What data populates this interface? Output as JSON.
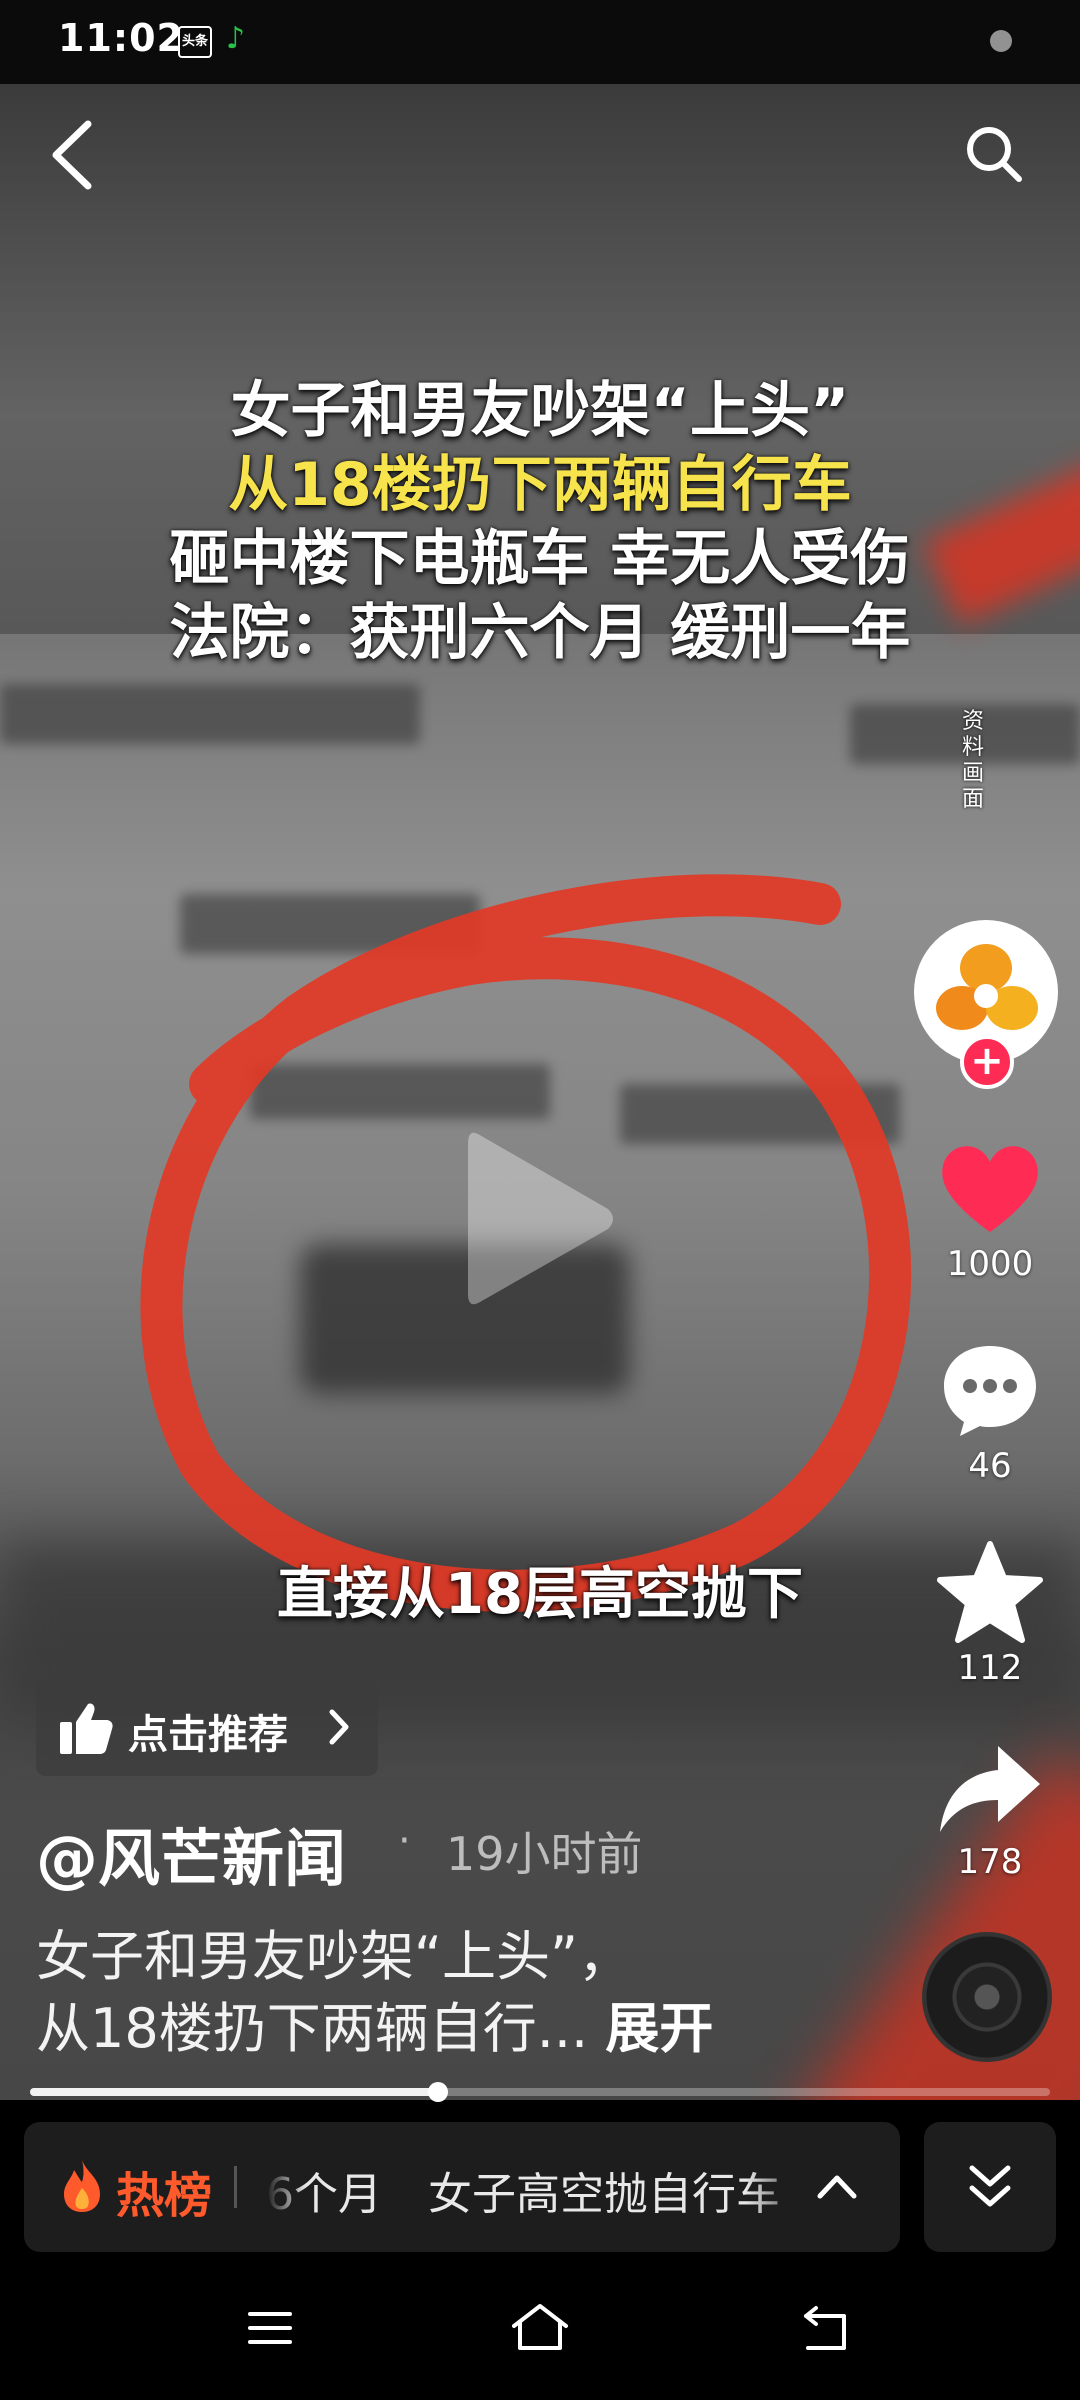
{
  "status_bar": {
    "time": "11:02",
    "app_badge": "头条",
    "icons": [
      "app-badge-icon",
      "music-note-icon"
    ]
  },
  "video": {
    "headline": [
      "女子和男友吵架“上头”",
      "从18楼扔下两辆自行车",
      "砸中楼下电瓶车 幸无人受伤",
      "法院：获刑六个月 缓刑一年"
    ],
    "side_watermark": "资料画面",
    "caption": "直接从18层高空抛下",
    "state": "paused",
    "progress": 0.4
  },
  "actions": {
    "like_count": "1000",
    "comment_count": "46",
    "favorite_count": "112",
    "share_count": "178"
  },
  "recommend": {
    "label": "点击推荐"
  },
  "post": {
    "author": "@风芒新闻",
    "separator": "·",
    "time": "19小时前",
    "description_line1": "女子和男友吵架“上头”，",
    "description_line2": "从18楼扔下两辆自行...",
    "expand_label": "展开"
  },
  "hot_bar": {
    "label": "热榜",
    "items": [
      "6个月",
      "女子高空抛自行车"
    ]
  },
  "colors": {
    "accent_red": "#fe2c55",
    "hot_orange": "#ff5a2c",
    "headline_yellow": "#f7e34b"
  }
}
